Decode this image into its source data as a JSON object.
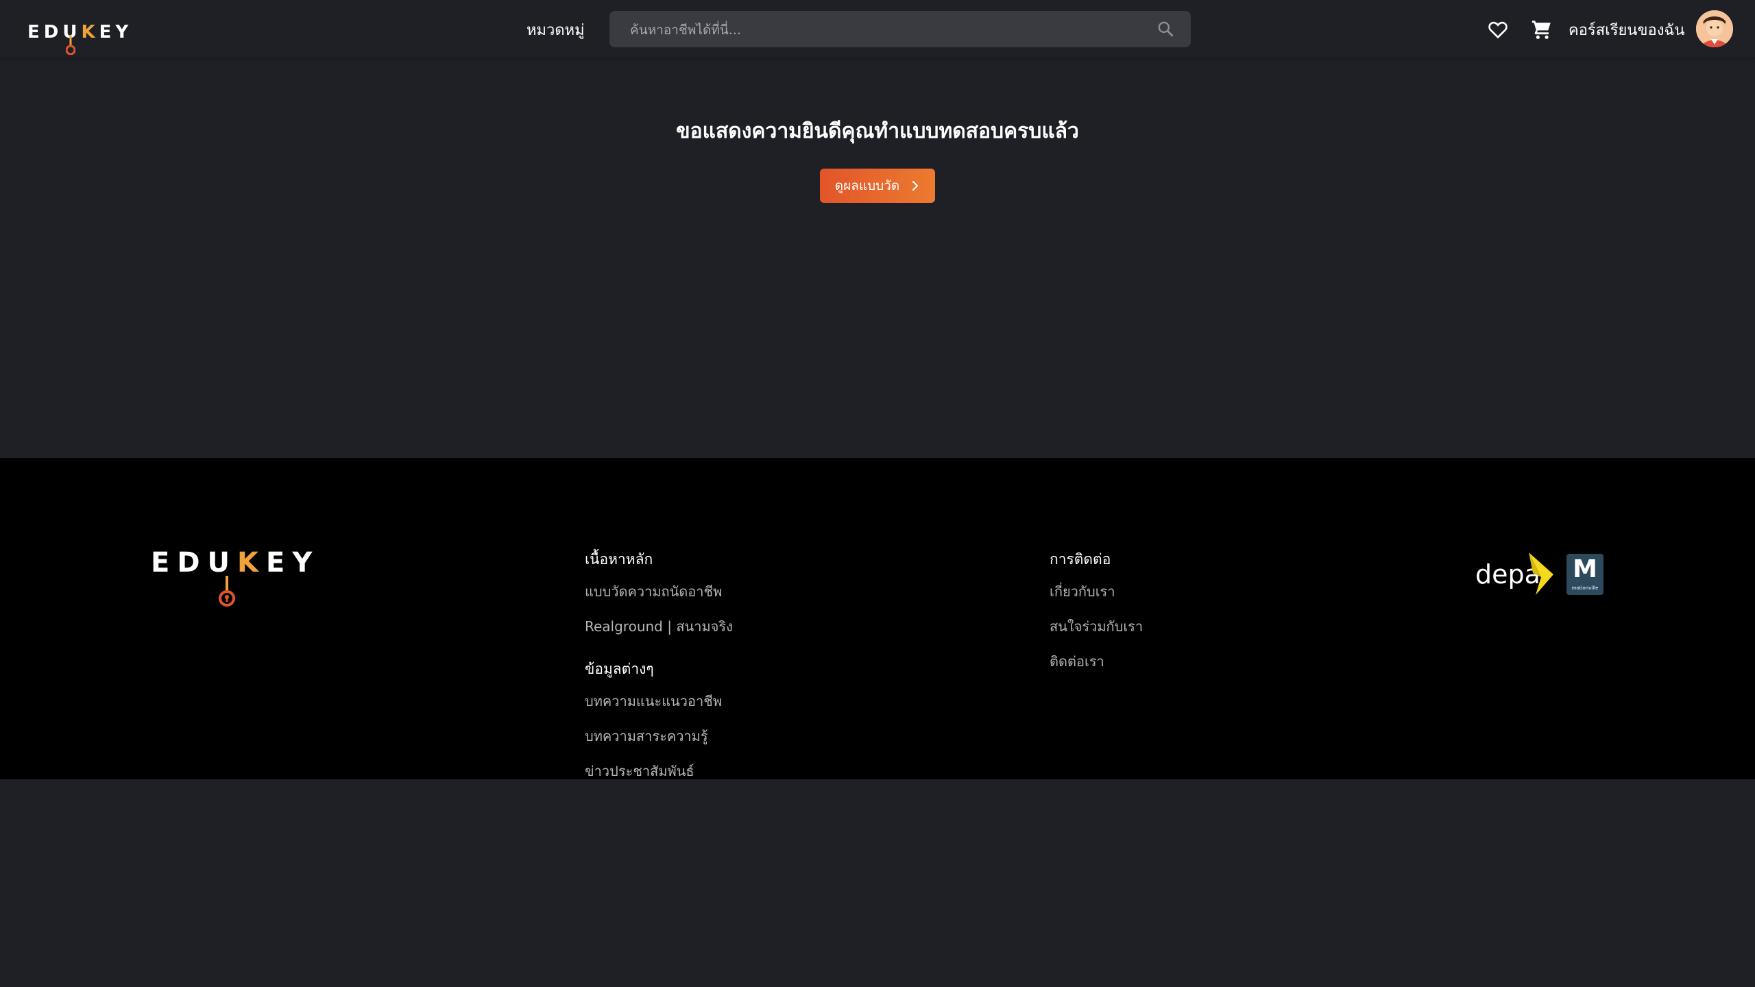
{
  "header": {
    "logo_text_left": "EDU",
    "logo_text_k": "K",
    "logo_text_right": "EY",
    "category_label": "หมวดหมู่",
    "search_placeholder": "ค้นหาอาชีพได้ที่นี่...",
    "my_courses_label": "คอร์สเรียนของฉัน",
    "icons": [
      "search-icon",
      "heart-icon",
      "cart-icon",
      "avatar"
    ]
  },
  "main": {
    "title": "ขอแสดงความยินดีคุณทำแบบทดสอบครบแล้ว",
    "result_button_label": "ดูผลแบบวัด"
  },
  "footer": {
    "logo_text_left": "EDU",
    "logo_text_k": "K",
    "logo_text_right": "EY",
    "col1": {
      "heading1": "เนื้อหาหลัก",
      "links1": [
        "แบบวัดความถนัดอาชีพ",
        "Realground | สนามจริง"
      ],
      "heading2": "ข้อมูลต่างๆ",
      "links2": [
        "บทความแนะแนวอาชีพ",
        "บทความสาระความรู้",
        "ข่าวประชาสัมพันธ์"
      ]
    },
    "col2": {
      "heading": "การติดต่อ",
      "links": [
        "เกี่ยวกับเรา",
        "สนใจร่วมกับเรา",
        "ติดต่อเรา"
      ]
    },
    "partners": {
      "depa_text": "depa",
      "motionville_mark": "M",
      "motionville_text": "motionville"
    }
  },
  "colors": {
    "background": "#1f2026",
    "footer_background": "#000000",
    "accent_start": "#e2552a",
    "accent_end": "#ec7b2f",
    "logo_key": "#f0a33a",
    "depa_yellow": "#f5d91e"
  }
}
